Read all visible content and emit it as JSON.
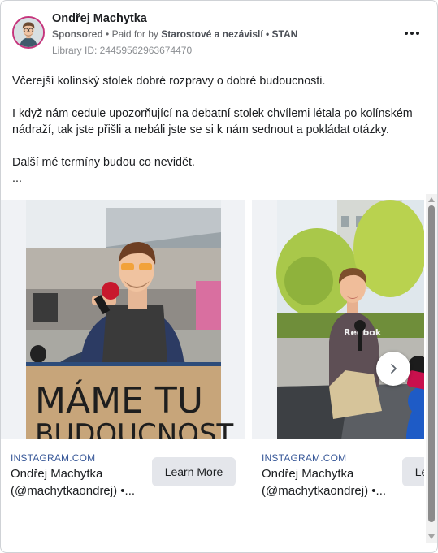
{
  "ad": {
    "page_name": "Ondřej Machytka",
    "sponsored_label": "Sponsored",
    "paid_for_label": "Paid for by",
    "paid_for_entity": "Starostové a nezávislí • STAN",
    "separator": "•",
    "library_id": "Library ID: 24459562963674470"
  },
  "body": {
    "paragraph_1": "Včerejší kolínský stolek dobré rozpravy o dobré budoucnosti.",
    "paragraph_2": "I když nám cedule upozorňující na debatní stolek chvílemi létala po kolínském nádraží, tak jste přišli a nebáli jste se si k nám sednout a pokládat otázky.",
    "paragraph_3": "Další mé termíny budou co nevidět.",
    "ellipsis": "..."
  },
  "carousel": {
    "cards": [
      {
        "domain": "INSTAGRAM.COM",
        "title": "Ondřej Machytka (@machytkaondrej) •...",
        "cta": "Learn More",
        "sign_text_1": "MÁME TU",
        "sign_text_2": "BUDOUCNOST"
      },
      {
        "domain": "INSTAGRAM.COM",
        "title": "Ondřej Machytka (@machytkaondrej) •...",
        "cta": "Learn More",
        "shirt_text": "Reebok"
      }
    ]
  },
  "icons": {
    "more": "more-horizontal-icon",
    "next": "chevron-right-icon",
    "scroll_up": "scroll-up-arrow-icon",
    "scroll_down": "scroll-down-arrow-icon"
  },
  "colors": {
    "link_blue": "#385898",
    "secondary_text": "#65676b",
    "avatar_ring": "#c5347c",
    "button_bg": "#e4e6eb"
  }
}
